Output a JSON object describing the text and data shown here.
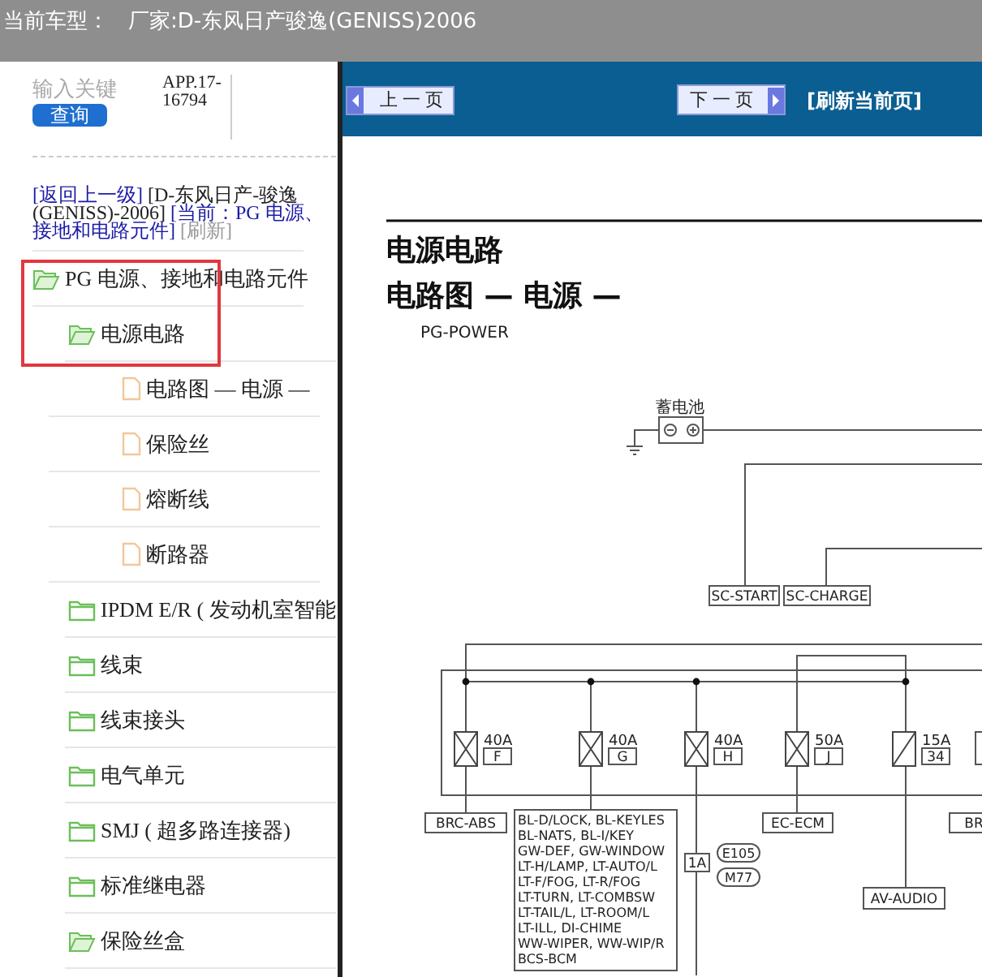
{
  "header": {
    "label": "当前车型：",
    "value": "厂家:D-东风日产骏逸(GENISS)2006"
  },
  "sidebar": {
    "search": {
      "placeholder": "输入关键",
      "button": "查询"
    },
    "code": "APP.17-16794",
    "breadcrumb": {
      "back": "[返回上一级]",
      "vehicle": "[D-东风日产-骏逸(GENISS)-2006]",
      "current": "[当前：PG 电源、接地和电路元件]",
      "refresh": "[刷新]"
    },
    "tree": [
      {
        "label": "PG 电源、接地和电路元件",
        "kind": "folder",
        "expanded": true,
        "children": [
          {
            "label": "电源电路",
            "kind": "folder",
            "expanded": true,
            "children": [
              {
                "label": "电路图 — 电源 —",
                "kind": "page"
              },
              {
                "label": "保险丝",
                "kind": "page"
              },
              {
                "label": "熔断线",
                "kind": "page"
              },
              {
                "label": "断路器",
                "kind": "page"
              }
            ]
          },
          {
            "label": "IPDM E/R ( 发动机室智能",
            "kind": "folder",
            "expanded": false
          },
          {
            "label": "线束",
            "kind": "folder",
            "expanded": false
          },
          {
            "label": "线束接头",
            "kind": "folder",
            "expanded": false
          },
          {
            "label": "电气单元",
            "kind": "folder",
            "expanded": false
          },
          {
            "label": "SMJ ( 超多路连接器)",
            "kind": "folder",
            "expanded": false
          },
          {
            "label": "标准继电器",
            "kind": "folder",
            "expanded": false
          },
          {
            "label": "保险丝盒",
            "kind": "folder",
            "expanded": true
          }
        ]
      }
    ]
  },
  "nav": {
    "prev": "上一页",
    "next": "下一页",
    "refresh": "[刷新当前页]"
  },
  "document": {
    "title": "电源电路",
    "subtitle": "电路图 — 电源 —",
    "code": "PG-POWER",
    "diagram": {
      "battery": "蓄电池",
      "signals": [
        "SC-START",
        "SC-CHARGE"
      ],
      "fuses": [
        {
          "rating": "40A",
          "id": "F",
          "kind": "cross"
        },
        {
          "rating": "40A",
          "id": "G",
          "kind": "cross"
        },
        {
          "rating": "40A",
          "id": "H",
          "kind": "cross"
        },
        {
          "rating": "50A",
          "id": "J",
          "kind": "cross"
        },
        {
          "rating": "15A",
          "id": "34",
          "kind": "slash"
        }
      ],
      "loads": [
        {
          "lines": [
            "BRC-ABS"
          ]
        },
        {
          "lines": [
            "BL-D/LOCK, BL-KEYLES",
            "BL-NATS, BL-I/KEY",
            "GW-DEF, GW-WINDOW",
            "LT-H/LAMP, LT-AUTO/L",
            "LT-F/FOG, LT-R/FOG",
            "LT-TURN, LT-COMBSW",
            "LT-TAIL/L, LT-ROOM/L",
            "LT-ILL, DI-CHIME",
            "WW-WIPER, WW-WIP/R",
            "BCS-BCM"
          ]
        },
        {
          "lines": [
            "EC-ECM"
          ]
        },
        {
          "lines": [
            "AV-AUDIO"
          ]
        },
        {
          "lines": [
            "BR"
          ]
        }
      ],
      "connector": {
        "pin": "1A",
        "names": [
          "E105",
          "M77"
        ]
      }
    }
  }
}
